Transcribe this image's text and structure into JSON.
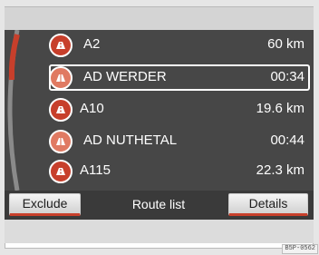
{
  "routes": [
    {
      "name": "A2",
      "value": "60 km",
      "icon": "motorway-icon",
      "selected": false
    },
    {
      "name": "AD WERDER",
      "value": "00:34",
      "icon": "motorway-junction-icon",
      "selected": true
    },
    {
      "name": "A10",
      "value": "19.6 km",
      "icon": "motorway-icon",
      "selected": false
    },
    {
      "name": "AD NUTHETAL",
      "value": "00:44",
      "icon": "motorway-junction-icon",
      "selected": false
    },
    {
      "name": "A115",
      "value": "22.3 km",
      "icon": "motorway-icon",
      "selected": false
    }
  ],
  "buttons": {
    "exclude": "Exclude",
    "details": "Details"
  },
  "title": "Route list",
  "image_code": "B5P-0562",
  "colors": {
    "accent": "#c73f2b",
    "list_background": "#474747",
    "button_bar": "#3a3a3a"
  }
}
